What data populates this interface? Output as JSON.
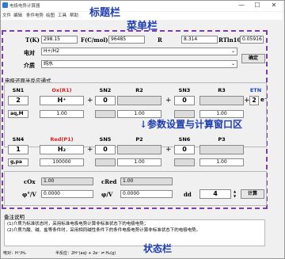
{
  "window": {
    "title": "电极电势计算器",
    "minimize": "—",
    "maximize": "☐",
    "close": "✕"
  },
  "menu": [
    "文件",
    "编辑",
    "条件电势",
    "绘图",
    "工具",
    "帮助"
  ],
  "annotations": {
    "title_bar": "标题栏",
    "menu_bar": "菜单栏",
    "params": "↓参数设置与计算窗口区",
    "status_bar": "状态栏"
  },
  "constants": {
    "t_label": "T(K)",
    "t_value": "298.15",
    "f_label": "F(C/mol)",
    "f_value": "96485",
    "r_label": "R",
    "r_value": "8.314",
    "rtln_label": "RTln10/F",
    "rtln_value": "0.05916"
  },
  "electrode": {
    "label": "电对",
    "value": "H+/H2"
  },
  "medium": {
    "label": "介质",
    "value": "纯水"
  },
  "confirm_button": "确定",
  "half_reaction": {
    "section_title": "电极还原半反应通式",
    "top": {
      "headers": [
        "SN1",
        "Ox(R1)",
        "SN2",
        "R2",
        "SN3",
        "R3",
        "ETN"
      ],
      "sn1": "2",
      "ox": "H⁺",
      "sn2": "0",
      "sn3": "0",
      "etn": "2",
      "electron": "e⁻",
      "unit": "aq,M",
      "ox_conc": "1.00",
      "r2_val": "1.00",
      "r3_val": "1.00"
    },
    "bottom": {
      "headers": [
        "SN4",
        "Red(P1)",
        "SN5",
        "P2",
        "SN6",
        "P3"
      ],
      "sn4": "1",
      "red": "H₂",
      "sn5": "0",
      "sn6": "0",
      "unit": "g,pa",
      "red_conc": "100000",
      "p2_val": "1.00",
      "p3_val": "1.00"
    }
  },
  "calc": {
    "cox_label": "cOx",
    "cox_value": "1.00",
    "cred_label": "cRed",
    "cred_value": "1.00",
    "phi0_label": "φ°/V",
    "phi0_value": "0.0000",
    "phi_label": "φ/V",
    "phi_value": "0.0000",
    "dd_label": "dd",
    "dd_value": "4",
    "calc_button": "计算"
  },
  "notes": {
    "title": "备注说明",
    "lines": [
      "(1)介质为标准状态时，采用标准电极电势计算非标准状态下的电极电势；",
      "(2)介质为酸、碱、盐等条件时，采用相同碱性条件下的条件电极电势计算非标准状态下的电极电势。"
    ]
  },
  "status": {
    "pair": "电对：H⁺/H₂",
    "reaction": "半反应：2H⁺(aq) + 2e⁻ ⇌ H₂(g)"
  }
}
